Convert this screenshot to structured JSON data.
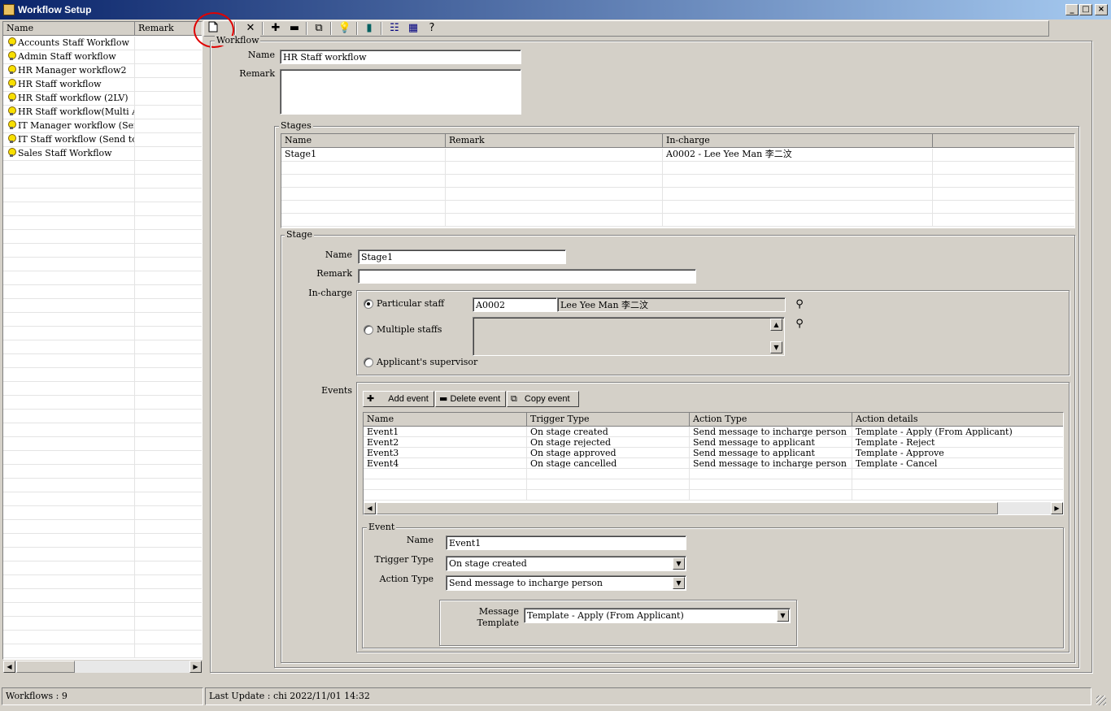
{
  "window": {
    "title": "Workflow Setup"
  },
  "list": {
    "columns": [
      "Name",
      "Remark"
    ],
    "items": [
      "Accounts Staff Workflow",
      "Admin Staff workflow",
      "HR Manager workflow2",
      "HR Staff workflow",
      "HR Staff workflow (2LV)",
      "HR Staff workflow(Multi A...",
      "IT Manager workflow (Sen...",
      "IT Staff workflow (Send to ...",
      "Sales Staff Workflow"
    ]
  },
  "workflow": {
    "group_label": "Workflow",
    "name_label": "Name",
    "name_value": "HR Staff workflow",
    "remark_label": "Remark",
    "remark_value": ""
  },
  "stages": {
    "group_label": "Stages",
    "columns": [
      "Name",
      "Remark",
      "In-charge"
    ],
    "rows": [
      {
        "name": "Stage1",
        "remark": "",
        "incharge": "A0002 - Lee Yee Man 李二汶"
      }
    ]
  },
  "stage": {
    "group_label": "Stage",
    "name_label": "Name",
    "name_value": "Stage1",
    "remark_label": "Remark",
    "remark_value": "",
    "incharge_label": "In-charge",
    "opt_particular": "Particular staff",
    "opt_multiple": "Multiple staffs",
    "opt_supervisor": "Applicant's supervisor",
    "staff_code": "A0002",
    "staff_name": "Lee Yee Man 李二汶"
  },
  "events": {
    "label": "Events",
    "add_label": "Add event",
    "delete_label": "Delete event",
    "copy_label": "Copy event",
    "columns": [
      "Name",
      "Trigger Type",
      "Action Type",
      "Action details"
    ],
    "rows": [
      {
        "name": "Event1",
        "trigger": "On stage created",
        "action": "Send message to incharge person",
        "details": "Template - Apply (From Applicant)"
      },
      {
        "name": "Event2",
        "trigger": "On stage rejected",
        "action": "Send message to applicant",
        "details": "Template - Reject"
      },
      {
        "name": "Event3",
        "trigger": "On stage approved",
        "action": "Send message to applicant",
        "details": "Template - Approve"
      },
      {
        "name": "Event4",
        "trigger": "On stage cancelled",
        "action": "Send message to incharge person",
        "details": "Template - Cancel"
      }
    ]
  },
  "event": {
    "group_label": "Event",
    "name_label": "Name",
    "name_value": "Event1",
    "trigger_label": "Trigger Type",
    "trigger_value": "On stage created",
    "action_label": "Action Type",
    "action_value": "Send message to incharge person",
    "template_label": "Message Template",
    "template_value": "Template - Apply (From Applicant)"
  },
  "status": {
    "count": "Workflows : 9",
    "last_update": "Last Update : chi 2022/11/01 14:32"
  },
  "icons": [
    "new-document-icon",
    "delete-x-icon",
    "plus-icon",
    "minus-icon",
    "copy-icon",
    "bulb-icon",
    "exit-door-icon",
    "list-view-icon",
    "grid-view-icon",
    "help-icon",
    "binoculars-icon"
  ]
}
